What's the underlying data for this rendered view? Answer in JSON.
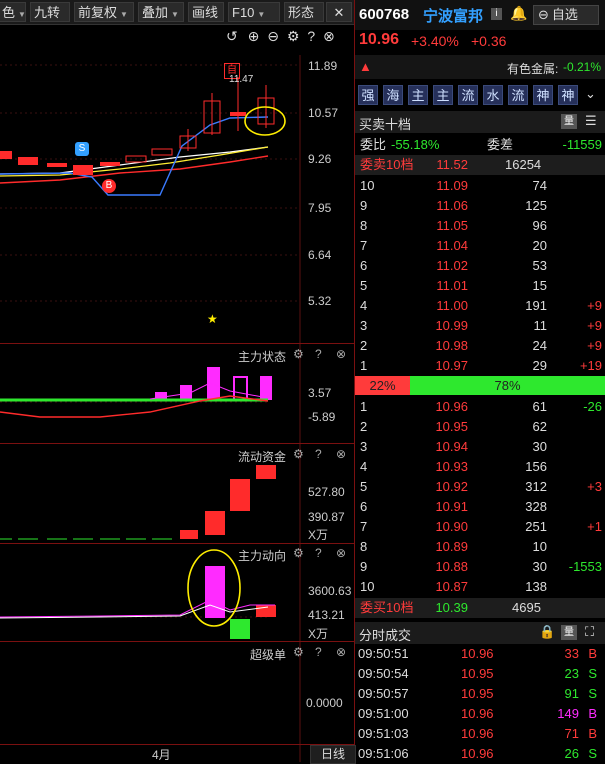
{
  "toolbar": {
    "items": [
      "色",
      "九转",
      "前复权",
      "叠加",
      "画线",
      "F10",
      "形态"
    ]
  },
  "main_chart": {
    "prices": [
      "11.89",
      "10.57",
      "9.26",
      "7.95",
      "6.64",
      "5.32"
    ],
    "high_label": "11.47",
    "marker_s": "S",
    "marker_b": "B",
    "marker_top": "自"
  },
  "panels": {
    "p1": {
      "title": "主力状态",
      "v1": "3.57",
      "v2": "-5.89"
    },
    "p2": {
      "title": "流动资金",
      "v1": "527.80",
      "v2": "390.87",
      "unit": "X万"
    },
    "p3": {
      "title": "主力动向",
      "v1": "3600.63",
      "v2": "413.21",
      "unit": "X万"
    },
    "p4": {
      "title": "超级单",
      "v1": "0.0000"
    }
  },
  "x_axis": {
    "month": "4月",
    "period": "日线"
  },
  "stock": {
    "code": "600768",
    "name": "宁波富邦",
    "info": "i",
    "watch_label": "自选",
    "price": "10.96",
    "pct": "+3.40%",
    "change": "+0.36",
    "sector_name": "有色金属:",
    "sector_pct": "-0.21%"
  },
  "tags": [
    "强",
    "海",
    "主",
    "主",
    "流",
    "水",
    "流",
    "神",
    "神"
  ],
  "order_book": {
    "title": "买卖十档",
    "weibi_label": "委比",
    "weibi": "-55.18%",
    "weicha_label": "委差",
    "weicha": "-11559",
    "sell_label": "委卖10档",
    "sell_avg": "11.52",
    "sell_total": "16254",
    "asks": [
      {
        "lvl": "10",
        "price": "11.09",
        "vol": "74",
        "chg": ""
      },
      {
        "lvl": "9",
        "price": "11.06",
        "vol": "125",
        "chg": ""
      },
      {
        "lvl": "8",
        "price": "11.05",
        "vol": "96",
        "chg": ""
      },
      {
        "lvl": "7",
        "price": "11.04",
        "vol": "20",
        "chg": ""
      },
      {
        "lvl": "6",
        "price": "11.02",
        "vol": "53",
        "chg": ""
      },
      {
        "lvl": "5",
        "price": "11.01",
        "vol": "15",
        "chg": ""
      },
      {
        "lvl": "4",
        "price": "11.00",
        "vol": "191",
        "chg": "+9"
      },
      {
        "lvl": "3",
        "price": "10.99",
        "vol": "11",
        "chg": "+9"
      },
      {
        "lvl": "2",
        "price": "10.98",
        "vol": "24",
        "chg": "+9"
      },
      {
        "lvl": "1",
        "price": "10.97",
        "vol": "29",
        "chg": "+19"
      }
    ],
    "ratio_sell": "22%",
    "ratio_buy": "78%",
    "sell_fraction": 0.22,
    "bids": [
      {
        "lvl": "1",
        "price": "10.96",
        "vol": "61",
        "chg": "-26"
      },
      {
        "lvl": "2",
        "price": "10.95",
        "vol": "62",
        "chg": ""
      },
      {
        "lvl": "3",
        "price": "10.94",
        "vol": "30",
        "chg": ""
      },
      {
        "lvl": "4",
        "price": "10.93",
        "vol": "156",
        "chg": ""
      },
      {
        "lvl": "5",
        "price": "10.92",
        "vol": "312",
        "chg": "+3"
      },
      {
        "lvl": "6",
        "price": "10.91",
        "vol": "328",
        "chg": ""
      },
      {
        "lvl": "7",
        "price": "10.90",
        "vol": "251",
        "chg": "+1"
      },
      {
        "lvl": "8",
        "price": "10.89",
        "vol": "10",
        "chg": ""
      },
      {
        "lvl": "9",
        "price": "10.88",
        "vol": "30",
        "chg": "-1553"
      },
      {
        "lvl": "10",
        "price": "10.87",
        "vol": "138",
        "chg": ""
      }
    ],
    "buy_label": "委买10档",
    "buy_avg": "10.39",
    "buy_total": "4695"
  },
  "ticks": {
    "title": "分时成交",
    "rows": [
      {
        "time": "09:50:51",
        "price": "10.96",
        "vol": "33",
        "side": "B",
        "color": "#ff3b3b"
      },
      {
        "time": "09:50:54",
        "price": "10.95",
        "vol": "23",
        "side": "S",
        "color": "#2ee82e"
      },
      {
        "time": "09:50:57",
        "price": "10.95",
        "vol": "91",
        "side": "S",
        "color": "#2ee82e"
      },
      {
        "time": "09:51:00",
        "price": "10.96",
        "vol": "149",
        "side": "B",
        "color": "#ff2bff"
      },
      {
        "time": "09:51:03",
        "price": "10.96",
        "vol": "71",
        "side": "B",
        "color": "#ff3b3b"
      },
      {
        "time": "09:51:06",
        "price": "10.96",
        "vol": "26",
        "side": "S",
        "color": "#2ee82e"
      }
    ]
  },
  "colors": {
    "up": "#ff3b3b",
    "down": "#2ee82e",
    "magenta": "#ff2bff",
    "accent": "#33a0ff"
  }
}
